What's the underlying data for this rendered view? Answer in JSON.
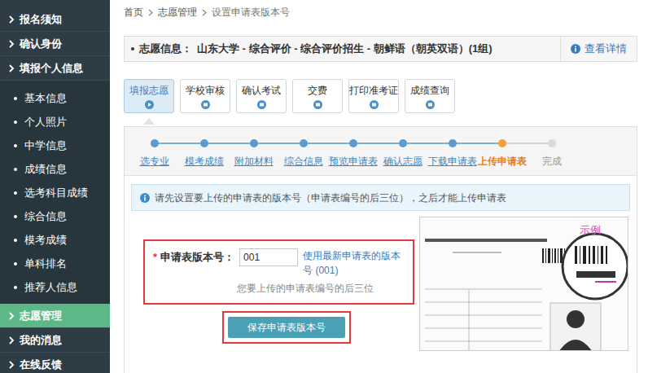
{
  "breadcrumb": [
    "首页",
    "志愿管理",
    "设置申请表版本号"
  ],
  "sidebar": {
    "items": [
      {
        "label": "报名须知",
        "kind": "group",
        "selected": false
      },
      {
        "label": "确认身份",
        "kind": "group",
        "selected": false
      },
      {
        "label": "填报个人信息",
        "kind": "group",
        "selected": false
      },
      {
        "label": "基本信息",
        "kind": "sub",
        "selected": false
      },
      {
        "label": "个人照片",
        "kind": "sub",
        "selected": false
      },
      {
        "label": "中学信息",
        "kind": "sub",
        "selected": false
      },
      {
        "label": "成绩信息",
        "kind": "sub",
        "selected": false
      },
      {
        "label": "选考科目成绩",
        "kind": "sub",
        "selected": false
      },
      {
        "label": "综合信息",
        "kind": "sub",
        "selected": false
      },
      {
        "label": "模考成绩",
        "kind": "sub",
        "selected": false
      },
      {
        "label": "单科排名",
        "kind": "sub",
        "selected": false
      },
      {
        "label": "推荐人信息",
        "kind": "sub",
        "selected": false
      },
      {
        "label": "志愿管理",
        "kind": "group",
        "selected": true
      },
      {
        "label": "我的消息",
        "kind": "group",
        "selected": false
      },
      {
        "label": "在线反馈",
        "kind": "group",
        "selected": false
      }
    ]
  },
  "volunteer_info": {
    "label": "志愿信息：",
    "value": "山东大学 - 综合评价 - 综合评价招生 - 朝鲜语（朝英双语）(1组)",
    "details_link": "查看详情"
  },
  "tabs": [
    {
      "label": "填报志愿",
      "selected": true
    },
    {
      "label": "学校审核",
      "selected": false
    },
    {
      "label": "确认考试",
      "selected": false
    },
    {
      "label": "交费",
      "selected": false
    },
    {
      "label": "打印准考证",
      "selected": false
    },
    {
      "label": "成绩查询",
      "selected": false
    }
  ],
  "steps": [
    {
      "label": "选专业",
      "status": "done"
    },
    {
      "label": "模考成绩",
      "status": "done"
    },
    {
      "label": "附加材料",
      "status": "done"
    },
    {
      "label": "综合信息",
      "status": "done"
    },
    {
      "label": "预览申请表",
      "status": "done"
    },
    {
      "label": "确认志愿",
      "status": "done"
    },
    {
      "label": "下载申请表",
      "status": "done"
    },
    {
      "label": "上传申请表",
      "status": "current"
    },
    {
      "label": "完成",
      "status": "todo"
    }
  ],
  "alert": "请先设置要上传的申请表的版本号（申请表编号的后三位），之后才能上传申请表",
  "form": {
    "required_mark": "*",
    "label": "申请表版本号：",
    "value": "001",
    "latest_link": "使用最新申请表的版本号 (001)",
    "hint": "您要上传的申请表编号的后三位",
    "save_button": "保存申请表版本号"
  },
  "sample": {
    "label": "示例"
  }
}
